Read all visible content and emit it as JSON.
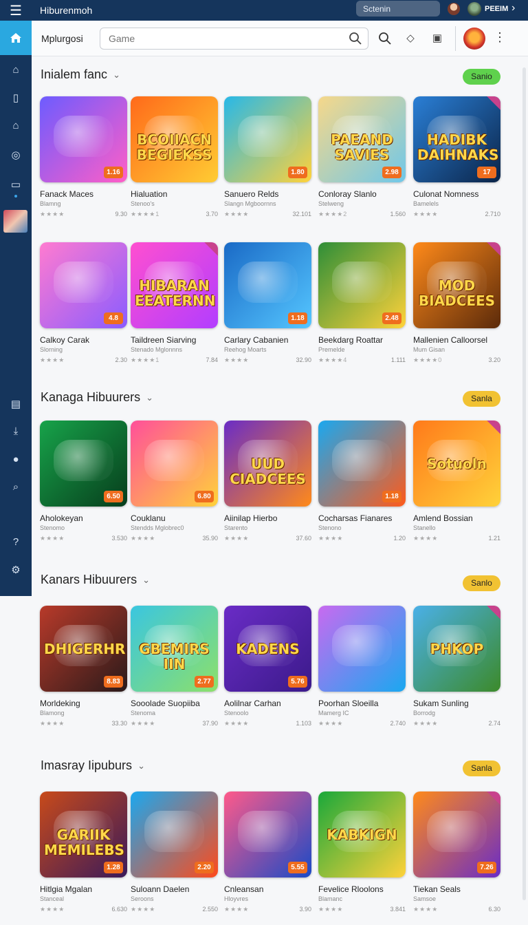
{
  "topbar": {
    "title": "Hiburenmoh",
    "search_text": "Sctenin",
    "user": "PEEIM"
  },
  "header": {
    "brand": "Mplurgosi",
    "search_placeholder": "Game"
  },
  "sections": [
    {
      "title": "Inialem fanc",
      "pill": "Sanio",
      "pill_color": "#5fd14d",
      "cards": [
        {
          "name": "Fanack Maces",
          "sub": "Blamng",
          "stars": "★★★★",
          "value": "9.30",
          "badge": "1.16",
          "colors": [
            "#6d5cff",
            "#ff5ec7"
          ],
          "word": ""
        },
        {
          "name": "Hialuation",
          "sub": "Stenoo's",
          "stars": "★★★★1",
          "value": "3.70",
          "badge": "",
          "colors": [
            "#ff6a1a",
            "#ffcc33"
          ],
          "word": "BCOIIACN BEGIEKSS"
        },
        {
          "name": "Sanuero Relds",
          "sub": "Slangn Mgboornns",
          "stars": "★★★★",
          "value": "32.101",
          "badge": "1.80",
          "colors": [
            "#27b8e8",
            "#ffd23a"
          ],
          "word": ""
        },
        {
          "name": "Conloray Slanlo",
          "sub": "Stelweng",
          "stars": "★★★★2",
          "value": "1.560",
          "badge": "2.98",
          "colors": [
            "#f6d88a",
            "#6fc7e9"
          ],
          "word": "PAEAND SAVIES"
        },
        {
          "name": "Culonat Nomness",
          "sub": "Bamelels",
          "stars": "★★★★",
          "value": "2.710",
          "badge": "17",
          "colors": [
            "#2a7fd6",
            "#0b2448"
          ],
          "word": "HADIBK DAIHNAKS"
        }
      ]
    },
    {
      "title": "",
      "pill": "",
      "pill_color": "",
      "cards": [
        {
          "name": "Calkoy Carak",
          "sub": "Slorning",
          "stars": "★★★★",
          "value": "2.30",
          "badge": "4.8",
          "colors": [
            "#ff7bd0",
            "#8a5cff"
          ],
          "word": ""
        },
        {
          "name": "Taildreen Siarving",
          "sub": "Stenado Mglonnns",
          "stars": "★★★★1",
          "value": "7.84",
          "badge": "",
          "colors": [
            "#ff4fd0",
            "#b23dff"
          ],
          "word": "HIBARAN EEATERNN"
        },
        {
          "name": "Carlary Cabanien",
          "sub": "Reehog Moarts",
          "stars": "★★★★",
          "value": "32.90",
          "badge": "1.18",
          "colors": [
            "#1a6ac6",
            "#55c6ff"
          ],
          "word": ""
        },
        {
          "name": "Beekdarg Roattar",
          "sub": "Premelde",
          "stars": "★★★★4",
          "value": "1.111",
          "badge": "2.48",
          "colors": [
            "#2e8e38",
            "#ffd23a"
          ],
          "word": ""
        },
        {
          "name": "Mallenien Calloorsel",
          "sub": "Mum Gisan",
          "stars": "★★★★0",
          "value": "3.20",
          "badge": "",
          "colors": [
            "#ff8a1a",
            "#5b2a0a"
          ],
          "word": "MOD BIADCEES"
        }
      ]
    },
    {
      "title": "Kanaga Hibuurers",
      "pill": "Sanla",
      "pill_color": "#f1c233",
      "cards": [
        {
          "name": "Aholokeyan",
          "sub": "Stenomo",
          "stars": "★★★★",
          "value": "3.530",
          "badge": "6.50",
          "colors": [
            "#17a34a",
            "#073d1c"
          ],
          "word": ""
        },
        {
          "name": "Couklanu",
          "sub": "Stendds Mglobrec0",
          "stars": "★★★★",
          "value": "35.90",
          "badge": "6.80",
          "colors": [
            "#ff4f9a",
            "#ffd23a"
          ],
          "word": ""
        },
        {
          "name": "Aiinilap Hierbo",
          "sub": "Starento",
          "stars": "★★★★",
          "value": "37.60",
          "badge": "",
          "colors": [
            "#6a2cc6",
            "#ff8a1a"
          ],
          "word": "UUD CIADCEES"
        },
        {
          "name": "Cocharsas Fianares",
          "sub": "Stenono",
          "stars": "★★★★",
          "value": "1.20",
          "badge": "1.18",
          "colors": [
            "#1aa8f0",
            "#ff5a1a"
          ],
          "word": ""
        },
        {
          "name": "Amlend Bossian",
          "sub": "Stanello",
          "stars": "★★★★",
          "value": "1.21",
          "badge": "",
          "colors": [
            "#ff7a1a",
            "#ffd23a"
          ],
          "word": "Sotuoln"
        }
      ]
    },
    {
      "title": "Kanars Hibuurers",
      "pill": "Sanlo",
      "pill_color": "#f1c233",
      "cards": [
        {
          "name": "Morldeking",
          "sub": "Blamong",
          "stars": "★★★★",
          "value": "33.30",
          "badge": "8.83",
          "colors": [
            "#b83a2a",
            "#2a1a1a"
          ],
          "word": "DHIGERHR"
        },
        {
          "name": "Sooolade Suopiiba",
          "sub": "Stenoma",
          "stars": "★★★★",
          "value": "37.90",
          "badge": "2.77",
          "colors": [
            "#3ac6e0",
            "#8de06a"
          ],
          "word": "GBEMIRS IIN"
        },
        {
          "name": "Aolilnar Carhan",
          "sub": "Stenoolo",
          "stars": "★★★★",
          "value": "1.103",
          "badge": "5.76",
          "colors": [
            "#6a2cc6",
            "#3b1a8a"
          ],
          "word": "KADENS"
        },
        {
          "name": "Poorhan Sloeilla",
          "sub": "Mamerg IC",
          "stars": "★★★★",
          "value": "2.740",
          "badge": "",
          "colors": [
            "#c86af0",
            "#1aa8f0"
          ],
          "word": ""
        },
        {
          "name": "Sukam Sunling",
          "sub": "Borrodg",
          "stars": "★★★★",
          "value": "2.74",
          "badge": "",
          "colors": [
            "#4ab0e8",
            "#3c8a2a"
          ],
          "word": "PHKOP"
        }
      ]
    },
    {
      "title": "Imasray Iipuburs",
      "pill": "Sanla",
      "pill_color": "#f1c233",
      "cards": [
        {
          "name": "Hitlgia Mgalan",
          "sub": "Stanceal",
          "stars": "★★★★",
          "value": "6.630",
          "badge": "1.28",
          "colors": [
            "#c84a1a",
            "#3a1a5a"
          ],
          "word": "GARIIK MEMILEBS"
        },
        {
          "name": "Suloann Daelen",
          "sub": "Seroons",
          "stars": "★★★★",
          "value": "2.550",
          "badge": "2.20",
          "colors": [
            "#1aa8f0",
            "#ff4a1a"
          ],
          "word": ""
        },
        {
          "name": "Cnleansan",
          "sub": "Hloyvres",
          "stars": "★★★★",
          "value": "3.90",
          "badge": "5.55",
          "colors": [
            "#ff5a8a",
            "#1a4ac6"
          ],
          "word": ""
        },
        {
          "name": "Fevelice Rloolons",
          "sub": "Blamanc",
          "stars": "★★★★",
          "value": "3.841",
          "badge": "",
          "colors": [
            "#1aa83a",
            "#ffd23a"
          ],
          "word": "KABKIGN"
        },
        {
          "name": "Tiekan Seals",
          "sub": "Samsoe",
          "stars": "★★★★",
          "value": "6.30",
          "badge": "7.26",
          "colors": [
            "#ff8a1a",
            "#6a2cc6"
          ],
          "word": ""
        }
      ]
    }
  ],
  "icons": [
    "menu-icon",
    "home-icon",
    "book-icon",
    "house-icon",
    "disc-icon",
    "monitor-icon",
    "list-icon",
    "download-icon",
    "person-icon",
    "search-icon",
    "help-icon",
    "gear-icon",
    "diamond-icon",
    "gallery-icon",
    "more-icon",
    "chevron-right-icon"
  ]
}
